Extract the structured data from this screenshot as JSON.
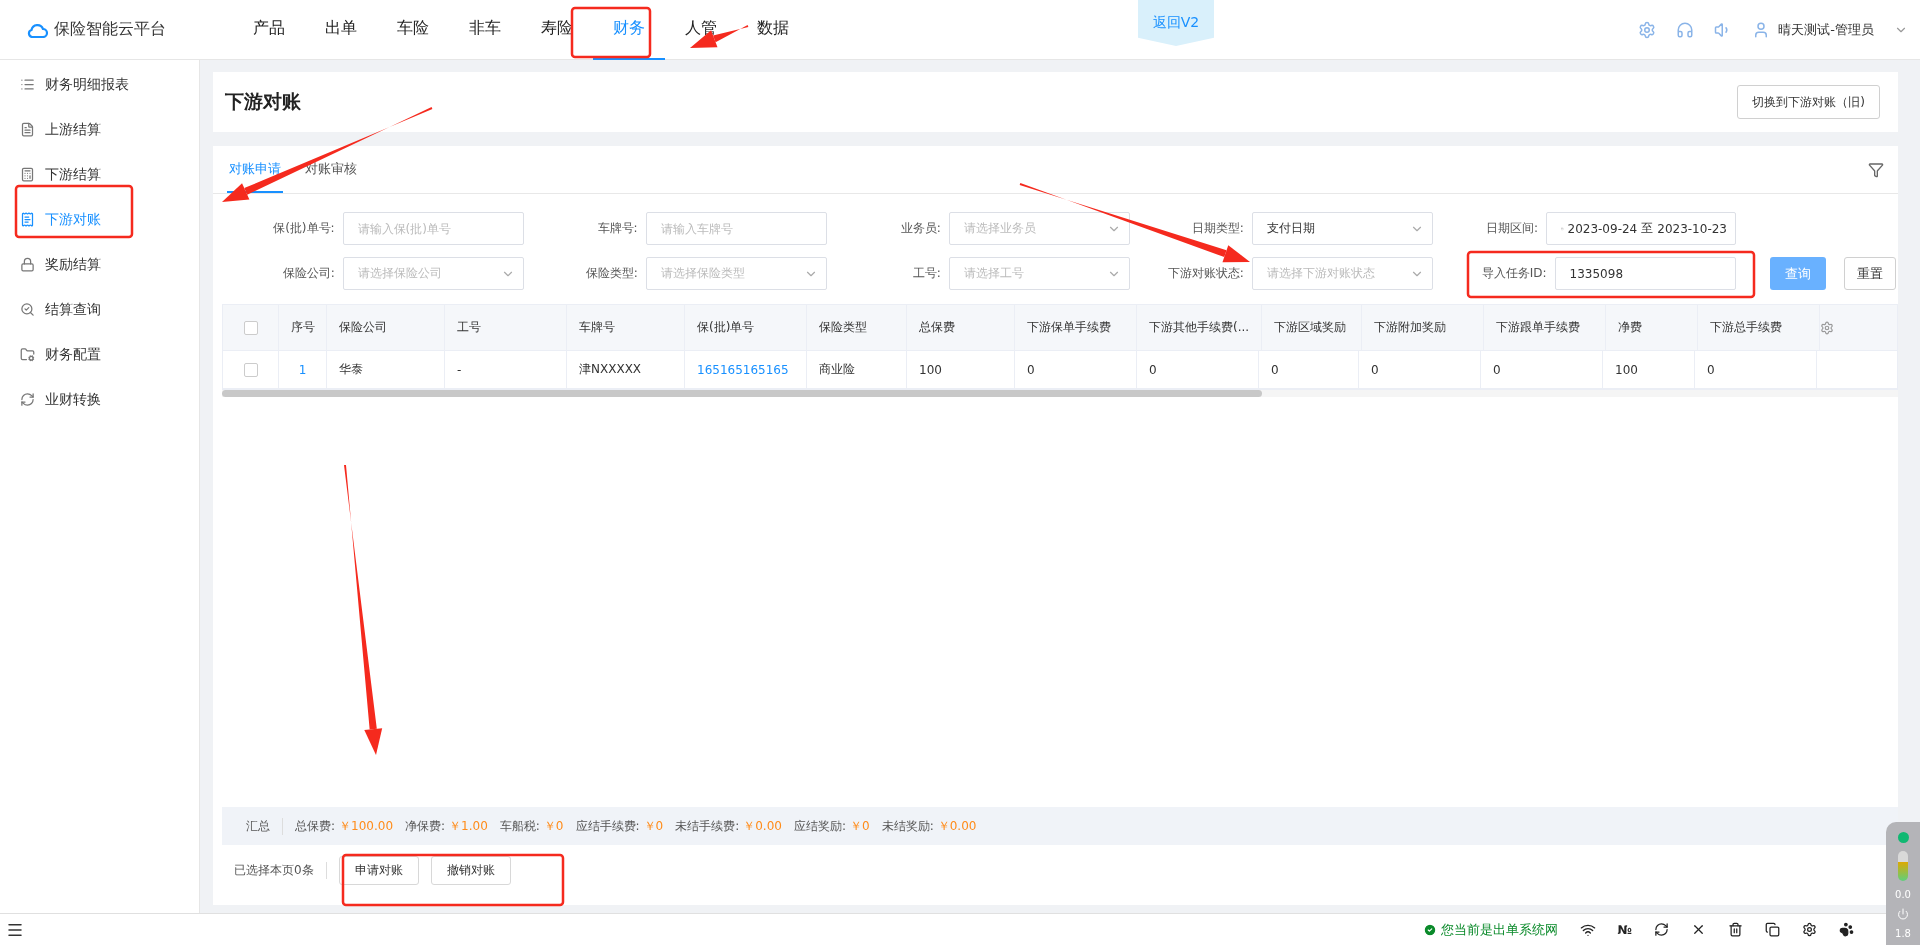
{
  "header": {
    "logo": "保险智能云平台",
    "nav": [
      {
        "label": "产品",
        "selected": false
      },
      {
        "label": "出单",
        "selected": false
      },
      {
        "label": "车险",
        "selected": false
      },
      {
        "label": "非车",
        "selected": false
      },
      {
        "label": "寿险",
        "selected": false
      },
      {
        "label": "财务",
        "selected": true
      },
      {
        "label": "人管",
        "selected": false
      },
      {
        "label": "数据",
        "selected": false
      }
    ],
    "version_tab": "返回V2",
    "user": "晴天测试-管理员"
  },
  "sidebar": {
    "items": [
      {
        "label": "财务明细报表",
        "selected": false
      },
      {
        "label": "上游结算",
        "selected": false
      },
      {
        "label": "下游结算",
        "selected": false
      },
      {
        "label": "下游对账",
        "selected": true
      },
      {
        "label": "奖励结算",
        "selected": false
      },
      {
        "label": "结算查询",
        "selected": false
      },
      {
        "label": "财务配置",
        "selected": false
      },
      {
        "label": "业财转换",
        "selected": false
      }
    ]
  },
  "page": {
    "title": "下游对账",
    "switch_button": "切换到下游对账（旧)"
  },
  "tabs": [
    {
      "label": "对账申请",
      "selected": true
    },
    {
      "label": "对账审核",
      "selected": false
    }
  ],
  "filters": [
    {
      "label": "保(批)单号:",
      "kind": "input",
      "placeholder": "请输入保(批)单号"
    },
    {
      "label": "车牌号:",
      "kind": "input",
      "placeholder": "请输入车牌号"
    },
    {
      "label": "业务员:",
      "kind": "select",
      "placeholder": "请选择业务员"
    },
    {
      "label": "日期类型:",
      "kind": "select",
      "value": "支付日期"
    },
    {
      "label": "日期区间:",
      "kind": "daterange",
      "start": "2023-09-24",
      "separator": "至",
      "end": "2023-10-23"
    },
    {
      "label": "保险公司:",
      "kind": "select",
      "placeholder": "请选择保险公司"
    },
    {
      "label": "保险类型:",
      "kind": "select",
      "placeholder": "请选择保险类型"
    },
    {
      "label": "工号:",
      "kind": "select",
      "placeholder": "请选择工号"
    },
    {
      "label": "下游对账状态:",
      "kind": "select",
      "placeholder": "请选择下游对账状态"
    },
    {
      "label": "导入任务ID:",
      "kind": "input",
      "value": "1335098"
    }
  ],
  "filter_buttons": {
    "search": "查询",
    "reset": "重置"
  },
  "table": {
    "header_checked": false,
    "columns": [
      "序号",
      "保险公司",
      "工号",
      "车牌号",
      "保(批)单号",
      "保险类型",
      "总保费",
      "下游保单手续费",
      "下游其他手续费(...",
      "下游区域奖励",
      "下游附加奖励",
      "下游跟单手续费",
      "净费",
      "下游总手续费"
    ],
    "rows": [
      {
        "checked": false,
        "cells": [
          "1",
          "华泰",
          "-",
          "津NXXXXX",
          "165165165165",
          "商业险",
          "100",
          "0",
          "0",
          "0",
          "0",
          "0",
          "100",
          "0"
        ]
      }
    ]
  },
  "summary": {
    "label": "汇总",
    "items": [
      {
        "label": "总保费:",
        "value": "￥100.00"
      },
      {
        "label": "净保费:",
        "value": "￥1.00"
      },
      {
        "label": "车船税:",
        "value": "￥0"
      },
      {
        "label": "应结手续费:",
        "value": "￥0"
      },
      {
        "label": "未结手续费:",
        "value": "￥0.00"
      },
      {
        "label": "应结奖励:",
        "value": "￥0"
      },
      {
        "label": "未结奖励:",
        "value": "￥0.00"
      }
    ]
  },
  "actions": {
    "selected_count": "已选择本页0条",
    "buttons": [
      "申请对账",
      "撤销对账"
    ]
  },
  "status_bar": {
    "message": "您当前是出单系统网",
    "number_sign": "№"
  },
  "monitor": {
    "upload": "0.0",
    "download": "1.8"
  }
}
